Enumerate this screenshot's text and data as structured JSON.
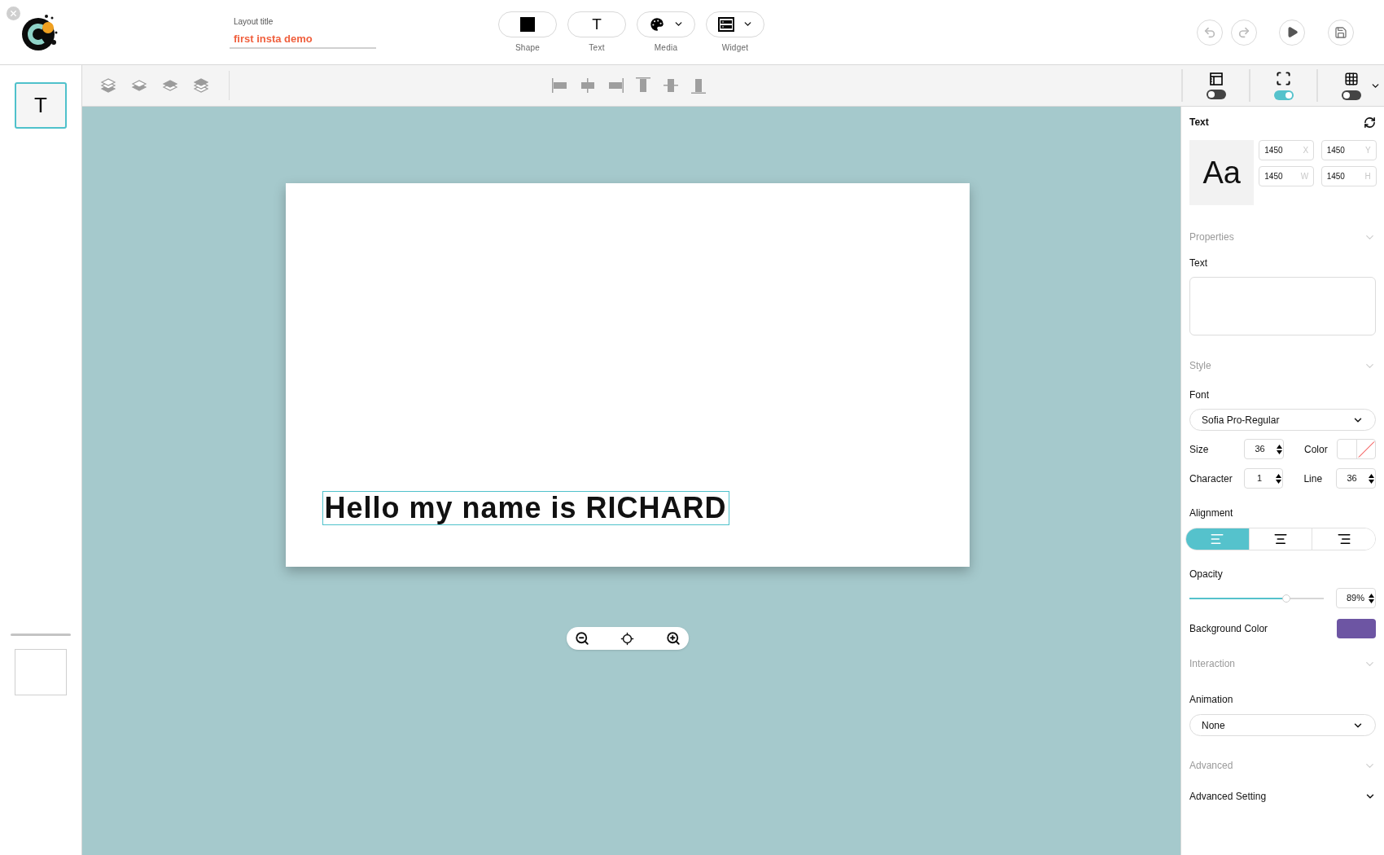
{
  "layout_title": {
    "label": "Layout title",
    "value": "first insta demo"
  },
  "insert_tools": [
    {
      "kind": "shape",
      "label": "Shape",
      "dropdown": false
    },
    {
      "kind": "text",
      "label": "Text",
      "glyph": "T",
      "dropdown": false
    },
    {
      "kind": "media",
      "label": "Media",
      "dropdown": true
    },
    {
      "kind": "widget",
      "label": "Widget",
      "dropdown": true
    }
  ],
  "slides": [
    {
      "glyph": "T",
      "selected": true
    },
    {
      "selected": false
    }
  ],
  "view_toggles": [
    {
      "kind": "rulers",
      "on": false
    },
    {
      "kind": "frame",
      "on": true
    },
    {
      "kind": "grid",
      "on": false
    }
  ],
  "canvas": {
    "text": "Hello my name is RICHARD",
    "selected": true
  },
  "panel": {
    "title": "Text",
    "preview": "Aa",
    "geometry": [
      {
        "value": "1450",
        "axis": "X"
      },
      {
        "value": "1450",
        "axis": "Y"
      },
      {
        "value": "1450",
        "axis": "W"
      },
      {
        "value": "1450",
        "axis": "H"
      }
    ],
    "properties_header": "Properties",
    "text_label": "Text",
    "style_header": "Style",
    "font": {
      "label": "Font",
      "value": "Sofia Pro-Regular"
    },
    "size": {
      "label": "Size",
      "value": "36"
    },
    "color": {
      "label": "Color"
    },
    "character": {
      "label": "Character",
      "value": "1"
    },
    "line": {
      "label": "Line",
      "value": "36"
    },
    "alignment": {
      "label": "Alignment",
      "options": [
        {
          "kind": "left",
          "selected": true
        },
        {
          "kind": "center",
          "selected": false
        },
        {
          "kind": "right",
          "selected": false
        }
      ]
    },
    "opacity": {
      "label": "Opacity",
      "level": 0.72,
      "reading": "89%"
    },
    "background_color": {
      "label": "Background Color",
      "color": "#6d55a3"
    },
    "interaction_header": "Interaction",
    "animation": {
      "label": "Animation",
      "value": "None"
    },
    "advanced_header": "Advanced",
    "advanced_setting": {
      "label": "Advanced Setting",
      "expanded": false
    }
  }
}
